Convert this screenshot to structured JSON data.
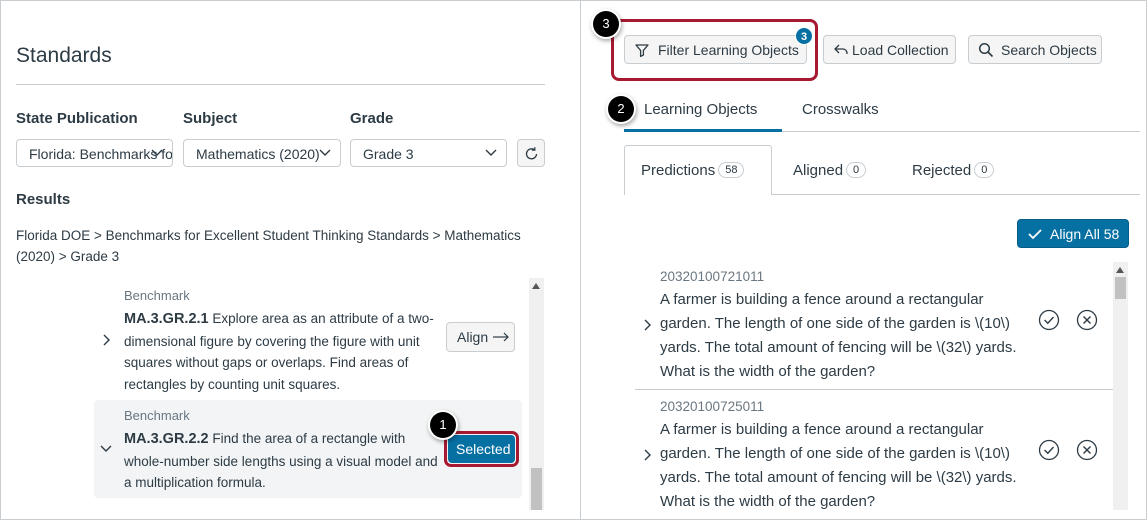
{
  "left": {
    "title": "Standards",
    "filters": {
      "state_label": "State Publication",
      "state_value": "Florida: Benchmarks for Excellent Student Thinking Standards",
      "subject_label": "Subject",
      "subject_value": "Mathematics (2020)",
      "grade_label": "Grade",
      "grade_value": "Grade 3"
    },
    "results_label": "Results",
    "breadcrumb": "Florida DOE > Benchmarks for Excellent Student Thinking Standards > Mathematics (2020) > Grade 3",
    "benchmarks": [
      {
        "type": "Benchmark",
        "code": "MA.3.GR.2.1",
        "text": " Explore area as an attribute of a two-dimensional figure by covering the figure with unit squares without gaps or overlaps. Find areas of rectangles by counting unit squares.",
        "action": "Align",
        "action_icon": "arrow-right-icon"
      },
      {
        "type": "Benchmark",
        "code": "MA.3.GR.2.2",
        "text": " Find the area of a rectangle with whole-number side lengths using a visual model and a multiplication formula.",
        "action": "Selected"
      }
    ]
  },
  "callouts": [
    "1",
    "2",
    "3"
  ],
  "toolbar": {
    "filter_label": "Filter Learning Objects",
    "filter_badge": "3",
    "load_label": "Load Collection",
    "search_label": "Search Objects"
  },
  "tabs": [
    "Learning Objects",
    "Crosswalks"
  ],
  "subtabs": [
    {
      "label": "Predictions",
      "count": "58"
    },
    {
      "label": "Aligned",
      "count": "0"
    },
    {
      "label": "Rejected",
      "count": "0"
    }
  ],
  "align_all_label": "Align All 58",
  "items": [
    {
      "id": "20320100721011",
      "question": "A farmer is building a fence around a rectangular garden. The length of one side of the garden is \\(10\\) yards. The total amount of fencing will be \\(32\\) yards. What is the width of the garden?"
    },
    {
      "id": "20320100725011",
      "question": "A farmer is building a fence around a rectangular garden. The length of one side of the garden is \\(10\\) yards. The total amount of fencing will be \\(32\\) yards. What is the width of the garden?"
    }
  ],
  "colors": {
    "accent": "#0770a3",
    "highlight": "#a71931",
    "border": "#c7cdd1"
  }
}
